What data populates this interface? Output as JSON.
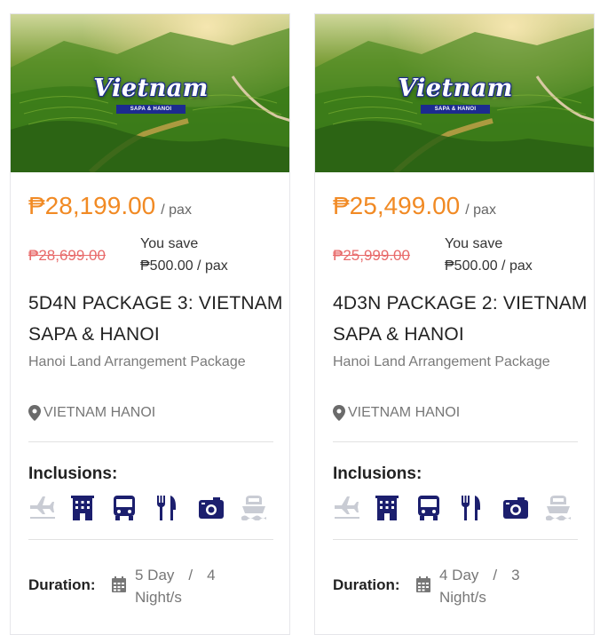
{
  "colors": {
    "price": "#f18a24",
    "old_price": "#e86a6a",
    "icon_active": "#1c1f6e",
    "icon_inactive": "#c9ccd4",
    "badge_bg": "#1c2b8f"
  },
  "cards": [
    {
      "hero_title": "Vietnam",
      "hero_badge": "SAPA & HANOI",
      "price": "₱28,199.00",
      "per": "/ pax",
      "old_price": "₱28,699.00",
      "save_label": "You save",
      "save_amount": "₱500.00 / pax",
      "title": "5D4N PACKAGE 3: VIETNAM SAPA & HANOI",
      "subtitle": "Hanoi Land Arrangement Package",
      "location": "VIETNAM HANOI",
      "inclusions_label": "Inclusions:",
      "inclusions": [
        {
          "icon": "plane-icon",
          "included": false
        },
        {
          "icon": "hotel-icon",
          "included": true
        },
        {
          "icon": "bus-icon",
          "included": true
        },
        {
          "icon": "utensils-icon",
          "included": true
        },
        {
          "icon": "camera-icon",
          "included": true
        },
        {
          "icon": "ship-icon",
          "included": false
        }
      ],
      "duration_label": "Duration:",
      "duration_days": "5 Day",
      "duration_sep": "/",
      "duration_nights_num": "4",
      "duration_nights": "Night/s"
    },
    {
      "hero_title": "Vietnam",
      "hero_badge": "SAPA & HANOI",
      "price": "₱25,499.00",
      "per": "/ pax",
      "old_price": "₱25,999.00",
      "save_label": "You save",
      "save_amount": "₱500.00 / pax",
      "title": "4D3N PACKAGE 2: VIETNAM SAPA & HANOI",
      "subtitle": "Hanoi Land Arrangement Package",
      "location": "VIETNAM HANOI",
      "inclusions_label": "Inclusions:",
      "inclusions": [
        {
          "icon": "plane-icon",
          "included": false
        },
        {
          "icon": "hotel-icon",
          "included": true
        },
        {
          "icon": "bus-icon",
          "included": true
        },
        {
          "icon": "utensils-icon",
          "included": true
        },
        {
          "icon": "camera-icon",
          "included": true
        },
        {
          "icon": "ship-icon",
          "included": false
        }
      ],
      "duration_label": "Duration:",
      "duration_days": "4 Day",
      "duration_sep": "/",
      "duration_nights_num": "3",
      "duration_nights": "Night/s"
    }
  ]
}
